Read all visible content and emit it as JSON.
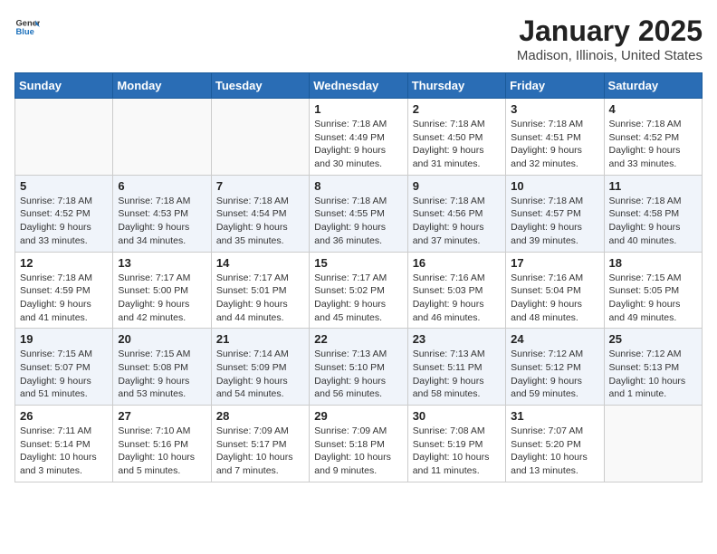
{
  "header": {
    "logo_general": "General",
    "logo_blue": "Blue",
    "month": "January 2025",
    "location": "Madison, Illinois, United States"
  },
  "weekdays": [
    "Sunday",
    "Monday",
    "Tuesday",
    "Wednesday",
    "Thursday",
    "Friday",
    "Saturday"
  ],
  "weeks": [
    [
      {
        "day": "",
        "info": ""
      },
      {
        "day": "",
        "info": ""
      },
      {
        "day": "",
        "info": ""
      },
      {
        "day": "1",
        "info": "Sunrise: 7:18 AM\nSunset: 4:49 PM\nDaylight: 9 hours\nand 30 minutes."
      },
      {
        "day": "2",
        "info": "Sunrise: 7:18 AM\nSunset: 4:50 PM\nDaylight: 9 hours\nand 31 minutes."
      },
      {
        "day": "3",
        "info": "Sunrise: 7:18 AM\nSunset: 4:51 PM\nDaylight: 9 hours\nand 32 minutes."
      },
      {
        "day": "4",
        "info": "Sunrise: 7:18 AM\nSunset: 4:52 PM\nDaylight: 9 hours\nand 33 minutes."
      }
    ],
    [
      {
        "day": "5",
        "info": "Sunrise: 7:18 AM\nSunset: 4:52 PM\nDaylight: 9 hours\nand 33 minutes."
      },
      {
        "day": "6",
        "info": "Sunrise: 7:18 AM\nSunset: 4:53 PM\nDaylight: 9 hours\nand 34 minutes."
      },
      {
        "day": "7",
        "info": "Sunrise: 7:18 AM\nSunset: 4:54 PM\nDaylight: 9 hours\nand 35 minutes."
      },
      {
        "day": "8",
        "info": "Sunrise: 7:18 AM\nSunset: 4:55 PM\nDaylight: 9 hours\nand 36 minutes."
      },
      {
        "day": "9",
        "info": "Sunrise: 7:18 AM\nSunset: 4:56 PM\nDaylight: 9 hours\nand 37 minutes."
      },
      {
        "day": "10",
        "info": "Sunrise: 7:18 AM\nSunset: 4:57 PM\nDaylight: 9 hours\nand 39 minutes."
      },
      {
        "day": "11",
        "info": "Sunrise: 7:18 AM\nSunset: 4:58 PM\nDaylight: 9 hours\nand 40 minutes."
      }
    ],
    [
      {
        "day": "12",
        "info": "Sunrise: 7:18 AM\nSunset: 4:59 PM\nDaylight: 9 hours\nand 41 minutes."
      },
      {
        "day": "13",
        "info": "Sunrise: 7:17 AM\nSunset: 5:00 PM\nDaylight: 9 hours\nand 42 minutes."
      },
      {
        "day": "14",
        "info": "Sunrise: 7:17 AM\nSunset: 5:01 PM\nDaylight: 9 hours\nand 44 minutes."
      },
      {
        "day": "15",
        "info": "Sunrise: 7:17 AM\nSunset: 5:02 PM\nDaylight: 9 hours\nand 45 minutes."
      },
      {
        "day": "16",
        "info": "Sunrise: 7:16 AM\nSunset: 5:03 PM\nDaylight: 9 hours\nand 46 minutes."
      },
      {
        "day": "17",
        "info": "Sunrise: 7:16 AM\nSunset: 5:04 PM\nDaylight: 9 hours\nand 48 minutes."
      },
      {
        "day": "18",
        "info": "Sunrise: 7:15 AM\nSunset: 5:05 PM\nDaylight: 9 hours\nand 49 minutes."
      }
    ],
    [
      {
        "day": "19",
        "info": "Sunrise: 7:15 AM\nSunset: 5:07 PM\nDaylight: 9 hours\nand 51 minutes."
      },
      {
        "day": "20",
        "info": "Sunrise: 7:15 AM\nSunset: 5:08 PM\nDaylight: 9 hours\nand 53 minutes."
      },
      {
        "day": "21",
        "info": "Sunrise: 7:14 AM\nSunset: 5:09 PM\nDaylight: 9 hours\nand 54 minutes."
      },
      {
        "day": "22",
        "info": "Sunrise: 7:13 AM\nSunset: 5:10 PM\nDaylight: 9 hours\nand 56 minutes."
      },
      {
        "day": "23",
        "info": "Sunrise: 7:13 AM\nSunset: 5:11 PM\nDaylight: 9 hours\nand 58 minutes."
      },
      {
        "day": "24",
        "info": "Sunrise: 7:12 AM\nSunset: 5:12 PM\nDaylight: 9 hours\nand 59 minutes."
      },
      {
        "day": "25",
        "info": "Sunrise: 7:12 AM\nSunset: 5:13 PM\nDaylight: 10 hours\nand 1 minute."
      }
    ],
    [
      {
        "day": "26",
        "info": "Sunrise: 7:11 AM\nSunset: 5:14 PM\nDaylight: 10 hours\nand 3 minutes."
      },
      {
        "day": "27",
        "info": "Sunrise: 7:10 AM\nSunset: 5:16 PM\nDaylight: 10 hours\nand 5 minutes."
      },
      {
        "day": "28",
        "info": "Sunrise: 7:09 AM\nSunset: 5:17 PM\nDaylight: 10 hours\nand 7 minutes."
      },
      {
        "day": "29",
        "info": "Sunrise: 7:09 AM\nSunset: 5:18 PM\nDaylight: 10 hours\nand 9 minutes."
      },
      {
        "day": "30",
        "info": "Sunrise: 7:08 AM\nSunset: 5:19 PM\nDaylight: 10 hours\nand 11 minutes."
      },
      {
        "day": "31",
        "info": "Sunrise: 7:07 AM\nSunset: 5:20 PM\nDaylight: 10 hours\nand 13 minutes."
      },
      {
        "day": "",
        "info": ""
      }
    ]
  ]
}
